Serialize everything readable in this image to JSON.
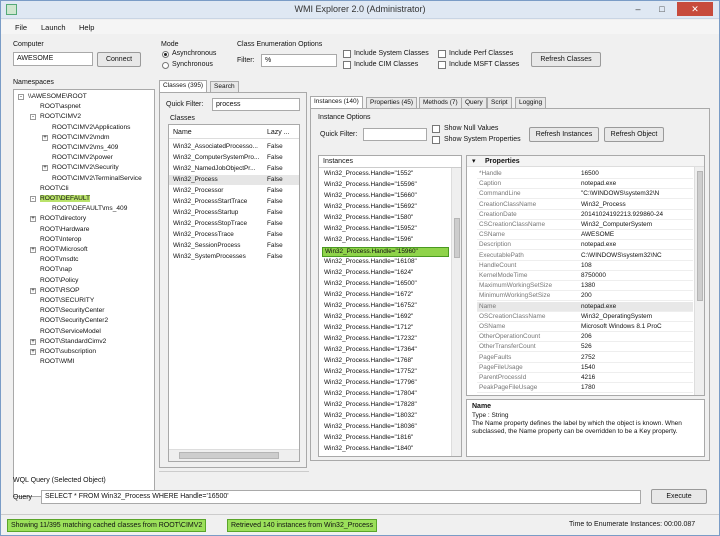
{
  "window": {
    "title": "WMI Explorer 2.0 (Administrator)"
  },
  "menu": [
    "File",
    "Launch",
    "Help"
  ],
  "computer": {
    "label": "Computer",
    "value": "AWESOME",
    "connect": "Connect"
  },
  "mode": {
    "label": "Mode",
    "async": "Asynchronous",
    "sync": "Synchronous"
  },
  "class_enum": {
    "label": "Class Enumeration Options",
    "filter_label": "Filter:",
    "filter_value": "%",
    "include_system": "Include System Classes",
    "include_cim": "Include CIM Classes",
    "include_perf": "Include Perf Classes",
    "include_msft": "Include MSFT Classes",
    "refresh": "Refresh Classes"
  },
  "namespaces": {
    "label": "Namespaces",
    "items": [
      {
        "text": "\\\\AWESOME\\ROOT",
        "exp": "-"
      },
      {
        "text": "ROOT\\aspnet",
        "exp": ""
      },
      {
        "text": "ROOT\\CIMV2",
        "exp": "-"
      },
      {
        "text": "ROOT\\CIMV2\\Applications",
        "exp": ""
      },
      {
        "text": "ROOT\\CIMV2\\mdm",
        "exp": "+"
      },
      {
        "text": "ROOT\\CIMV2\\ms_409",
        "exp": ""
      },
      {
        "text": "ROOT\\CIMV2\\power",
        "exp": ""
      },
      {
        "text": "ROOT\\CIMV2\\Security",
        "exp": "+"
      },
      {
        "text": "ROOT\\CIMV2\\TerminalService",
        "exp": ""
      },
      {
        "text": "ROOT\\Cli",
        "exp": ""
      },
      {
        "text": "ROOT\\DEFAULT",
        "exp": "-"
      },
      {
        "text": "ROOT\\DEFAULT\\ms_409",
        "exp": ""
      },
      {
        "text": "ROOT\\directory",
        "exp": "+"
      },
      {
        "text": "ROOT\\Hardware",
        "exp": ""
      },
      {
        "text": "ROOT\\Interop",
        "exp": ""
      },
      {
        "text": "ROOT\\Microsoft",
        "exp": "+"
      },
      {
        "text": "ROOT\\msdtc",
        "exp": ""
      },
      {
        "text": "ROOT\\nap",
        "exp": ""
      },
      {
        "text": "ROOT\\Policy",
        "exp": ""
      },
      {
        "text": "ROOT\\RSOP",
        "exp": "+"
      },
      {
        "text": "ROOT\\SECURITY",
        "exp": ""
      },
      {
        "text": "ROOT\\SecurityCenter",
        "exp": ""
      },
      {
        "text": "ROOT\\SecurityCenter2",
        "exp": ""
      },
      {
        "text": "ROOT\\ServiceModel",
        "exp": ""
      },
      {
        "text": "ROOT\\StandardCimv2",
        "exp": "+"
      },
      {
        "text": "ROOT\\subscription",
        "exp": "+"
      },
      {
        "text": "ROOT\\WMI",
        "exp": ""
      }
    ]
  },
  "classes_tabs": [
    "Classes (395)",
    "Search"
  ],
  "quick_filter": {
    "label": "Quick Filter:",
    "value": "process"
  },
  "classes": {
    "label": "Classes",
    "col_name": "Name",
    "col_lazy": "Lazy ...",
    "rows": [
      {
        "name": "Win32_AssociatedProcesso...",
        "lazy": "False"
      },
      {
        "name": "Win32_ComputerSystemPro...",
        "lazy": "False"
      },
      {
        "name": "Win32_NamedJobObjectPr...",
        "lazy": "False"
      },
      {
        "name": "Win32_Process",
        "lazy": "False"
      },
      {
        "name": "Win32_Processor",
        "lazy": "False"
      },
      {
        "name": "Win32_ProcessStartTrace",
        "lazy": "False"
      },
      {
        "name": "Win32_ProcessStartup",
        "lazy": "False"
      },
      {
        "name": "Win32_ProcessStopTrace",
        "lazy": "False"
      },
      {
        "name": "Win32_ProcessTrace",
        "lazy": "False"
      },
      {
        "name": "Win32_SessionProcess",
        "lazy": "False"
      },
      {
        "name": "Win32_SystemProcesses",
        "lazy": "False"
      }
    ]
  },
  "right_tabs": [
    "Instances (140)",
    "Properties (45)",
    "Methods (7)",
    "Query",
    "Script",
    "Logging"
  ],
  "instance_options": {
    "label": "Instance Options",
    "quick_filter": "Quick Filter:",
    "show_null": "Show Null Values",
    "show_system": "Show System Properties",
    "refresh_instances": "Refresh Instances",
    "refresh_object": "Refresh Object"
  },
  "instances": {
    "label": "Instances",
    "rows": [
      "Win32_Process.Handle=\"1552\"",
      "Win32_Process.Handle=\"15596\"",
      "Win32_Process.Handle=\"15660\"",
      "Win32_Process.Handle=\"15692\"",
      "Win32_Process.Handle=\"1580\"",
      "Win32_Process.Handle=\"15952\"",
      "Win32_Process.Handle=\"1596\"",
      "Win32_Process.Handle=\"15960\"",
      "Win32_Process.Handle=\"16108\"",
      "Win32_Process.Handle=\"1624\"",
      "Win32_Process.Handle=\"16500\"",
      "Win32_Process.Handle=\"1672\"",
      "Win32_Process.Handle=\"16752\"",
      "Win32_Process.Handle=\"1692\"",
      "Win32_Process.Handle=\"1712\"",
      "Win32_Process.Handle=\"17232\"",
      "Win32_Process.Handle=\"17364\"",
      "Win32_Process.Handle=\"1768\"",
      "Win32_Process.Handle=\"17752\"",
      "Win32_Process.Handle=\"17796\"",
      "Win32_Process.Handle=\"17804\"",
      "Win32_Process.Handle=\"17828\"",
      "Win32_Process.Handle=\"18032\"",
      "Win32_Process.Handle=\"18036\"",
      "Win32_Process.Handle=\"1816\"",
      "Win32_Process.Handle=\"1840\""
    ]
  },
  "properties": {
    "header": "Properties",
    "rows": [
      {
        "name": "*Handle",
        "value": "16500"
      },
      {
        "name": "Caption",
        "value": "notepad.exe"
      },
      {
        "name": "CommandLine",
        "value": "\"C:\\WINDOWS\\system32\\N"
      },
      {
        "name": "CreationClassName",
        "value": "Win32_Process"
      },
      {
        "name": "CreationDate",
        "value": "20141024192213.929860-24"
      },
      {
        "name": "CSCreationClassName",
        "value": "Win32_ComputerSystem"
      },
      {
        "name": "CSName",
        "value": "AWESOME"
      },
      {
        "name": "Description",
        "value": "notepad.exe"
      },
      {
        "name": "ExecutablePath",
        "value": "C:\\WINDOWS\\system32\\NC"
      },
      {
        "name": "HandleCount",
        "value": "108"
      },
      {
        "name": "KernelModeTime",
        "value": "8750000"
      },
      {
        "name": "MaximumWorkingSetSize",
        "value": "1380"
      },
      {
        "name": "MinimumWorkingSetSize",
        "value": "200"
      },
      {
        "name": "Name",
        "value": "notepad.exe"
      },
      {
        "name": "OSCreationClassName",
        "value": "Win32_OperatingSystem"
      },
      {
        "name": "OSName",
        "value": "Microsoft Windows 8.1 ProC"
      },
      {
        "name": "OtherOperationCount",
        "value": "206"
      },
      {
        "name": "OtherTransferCount",
        "value": "526"
      },
      {
        "name": "PageFaults",
        "value": "2752"
      },
      {
        "name": "PageFileUsage",
        "value": "1540"
      },
      {
        "name": "ParentProcessId",
        "value": "4216"
      },
      {
        "name": "PeakPageFileUsage",
        "value": "1780"
      }
    ]
  },
  "description": {
    "title": "Name",
    "type": "Type : String",
    "text": "The Name property defines the label by which the object is known. When subclassed, the Name property can be overridden to be a Key property."
  },
  "wql": {
    "label": "WQL Query (Selected Object)",
    "query_label": "Query",
    "query": "SELECT * FROM Win32_Process WHERE Handle='16500'",
    "execute": "Execute"
  },
  "status": {
    "left": "Showing 11/395 matching cached classes from ROOT\\CIMV2",
    "middle": "Retrieved 140 instances from Win32_Process",
    "right": "Time to Enumerate Instances: 00:00.087"
  }
}
